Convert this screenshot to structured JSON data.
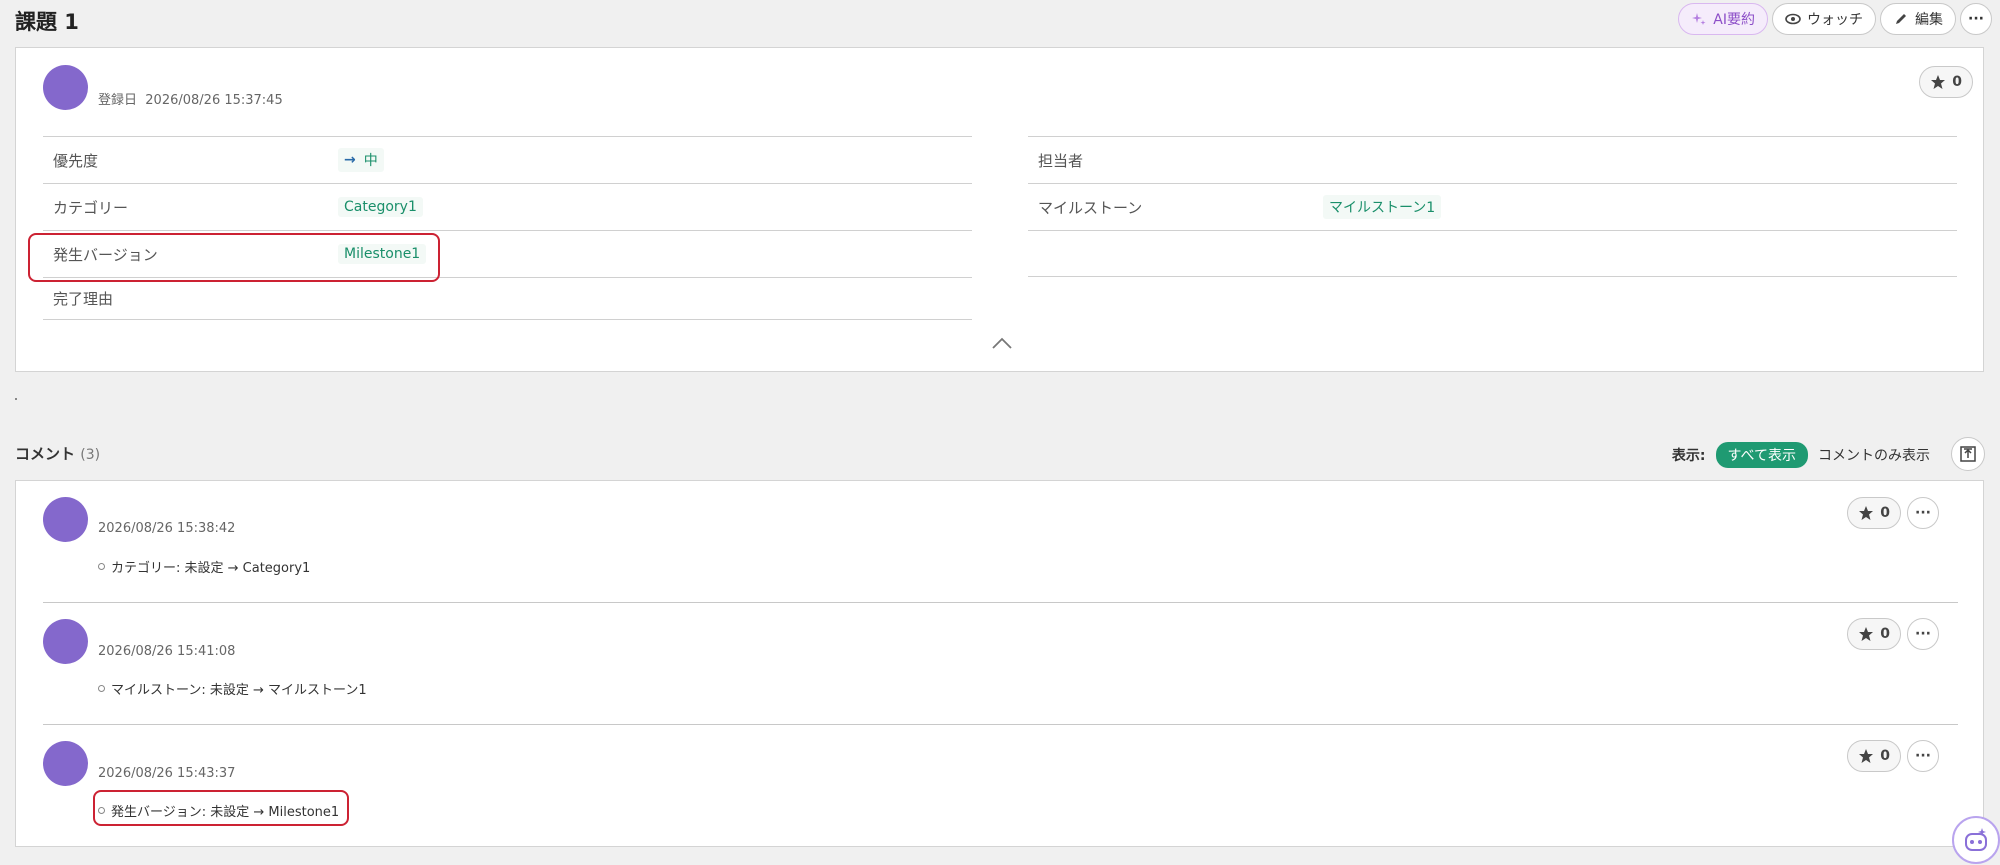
{
  "page": {
    "title": "課題 1"
  },
  "toolbar": {
    "ai_summary_label": "AI要約",
    "watch_label": "ウォッチ",
    "edit_label": "編集",
    "more_label": "···"
  },
  "issue": {
    "registered_label": "登録日",
    "registered_date": "2026/08/26 15:37:45",
    "star_count": "0",
    "left_props": [
      {
        "label": "優先度",
        "value": "中",
        "has_arrow": true
      },
      {
        "label": "カテゴリー",
        "value": "Category1"
      },
      {
        "label": "発生バージョン",
        "value": "Milestone1"
      },
      {
        "label": "完了理由",
        "value": ""
      }
    ],
    "right_props": [
      {
        "label": "担当者",
        "value": ""
      },
      {
        "label": "マイルストーン",
        "value": "マイルストーン1"
      },
      {
        "label": "",
        "value": ""
      }
    ]
  },
  "comments": {
    "heading": "コメント",
    "count": "(3)",
    "view_label": "表示:",
    "view_all": "すべて表示",
    "view_comments_only": "コメントのみ表示",
    "items": [
      {
        "date": "2026/08/26 15:38:42",
        "change": "カテゴリー: 未設定 → Category1",
        "stars": "0"
      },
      {
        "date": "2026/08/26 15:41:08",
        "change": "マイルストーン: 未設定 → マイルストーン1",
        "stars": "0"
      },
      {
        "date": "2026/08/26 15:43:37",
        "change": "発生バージョン: 未設定 → Milestone1",
        "stars": "0"
      }
    ]
  },
  "colors": {
    "accent": "#1f9a72",
    "avatar": "#8468cc",
    "highlight": "#cc2233"
  }
}
